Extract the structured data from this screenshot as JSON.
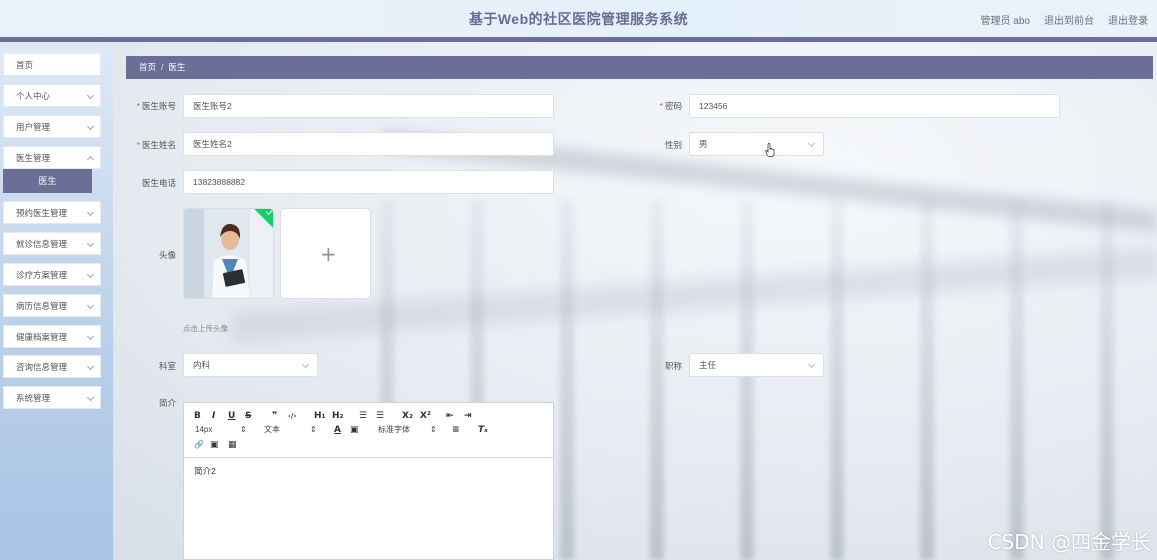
{
  "header": {
    "title": "基于Web的社区医院管理服务系统",
    "user_label": "管理员 abo",
    "to_front_label": "退出到前台",
    "logout_label": "退出登录"
  },
  "sidebar": {
    "items": [
      {
        "label": "首页"
      },
      {
        "label": "个人中心"
      },
      {
        "label": "用户管理"
      },
      {
        "label": "医生管理"
      },
      {
        "label": "医生"
      },
      {
        "label": "预约医生管理"
      },
      {
        "label": "就诊信息管理"
      },
      {
        "label": "诊疗方案管理"
      },
      {
        "label": "病历信息管理"
      },
      {
        "label": "健康档案管理"
      },
      {
        "label": "咨询信息管理"
      },
      {
        "label": "系统管理"
      }
    ]
  },
  "breadcrumb": {
    "home": "首页",
    "separator": "/",
    "current": "医生"
  },
  "form": {
    "account": {
      "label": "医生账号",
      "value": "医生账号2"
    },
    "password": {
      "label": "密码",
      "value": "123456"
    },
    "name": {
      "label": "医生姓名",
      "value": "医生姓名2"
    },
    "gender": {
      "label": "性别",
      "value": "男"
    },
    "phone": {
      "label": "医生电话",
      "value": "13823888882"
    },
    "avatar": {
      "label": "头像",
      "hint": "点击上传头像",
      "plus": "+"
    },
    "department": {
      "label": "科室",
      "value": "内科"
    },
    "title": {
      "label": "职称",
      "value": "主任"
    },
    "intro": {
      "label": "简介",
      "content": "简介2"
    }
  },
  "editor": {
    "font_size": "14px",
    "text_style": "文本",
    "font_family": "标准字体",
    "buttons": {
      "bold": "B",
      "italic": "I",
      "underline": "U",
      "strike": "S",
      "quote": "❞",
      "code": "‹/›",
      "h1": "H₁",
      "h2": "H₂",
      "ol": "☰",
      "ul": "☰",
      "sub": "X₂",
      "sup": "X²",
      "indent_left": "⇤",
      "indent_right": "⇥",
      "color": "A",
      "bg_color": "▣",
      "align": "≡",
      "clear": "Tₓ",
      "link": "🔗",
      "image": "▣",
      "video": "▦"
    }
  },
  "watermark": "CSDN @四金学长"
}
